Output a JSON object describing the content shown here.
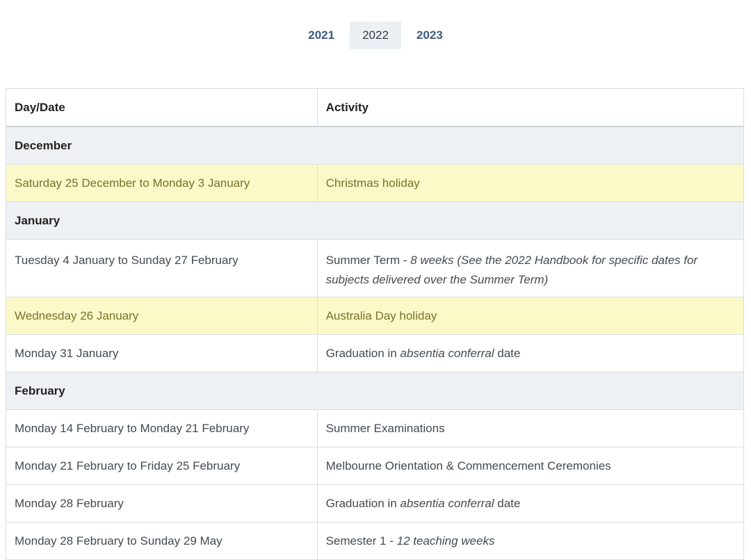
{
  "year_tabs": [
    {
      "label": "2021",
      "active": false
    },
    {
      "label": "2022",
      "active": true
    },
    {
      "label": "2023",
      "active": false
    }
  ],
  "table": {
    "headers": {
      "date": "Day/Date",
      "activity": "Activity"
    },
    "sections": [
      {
        "month": "December",
        "rows": [
          {
            "date": "Saturday 25 December to Monday 3 January",
            "activity": "Christmas holiday",
            "holiday": true
          }
        ]
      },
      {
        "month": "January",
        "rows": [
          {
            "date": "Tuesday 4 January to Sunday 27 February",
            "activity_pre": "Summer Term - ",
            "activity_em": "8 weeks  (See the 2022 Handbook for specific dates for subjects delivered over the Summer Term)",
            "activity_post": ""
          },
          {
            "date": "Wednesday 26 January",
            "activity": "Australia Day holiday",
            "holiday": true
          },
          {
            "date": "Monday 31 January",
            "activity_pre": "Graduation in ",
            "activity_em": "absentia conferral",
            "activity_post": " date"
          }
        ]
      },
      {
        "month": "February",
        "rows": [
          {
            "date": "Monday 14 February to Monday 21 February",
            "activity": "Summer Examinations"
          },
          {
            "date": "Monday 21 February to Friday 25 February",
            "activity": "Melbourne Orientation & Commencement Ceremonies"
          },
          {
            "date": "Monday 28 February",
            "activity_pre": "Graduation in ",
            "activity_em": "absentia conferral",
            "activity_post": " date"
          },
          {
            "date": "Monday 28 February to Sunday 29 May",
            "activity_pre": "Semester 1 - ",
            "activity_em": "12 teaching weeks",
            "activity_post": ""
          }
        ]
      }
    ]
  }
}
